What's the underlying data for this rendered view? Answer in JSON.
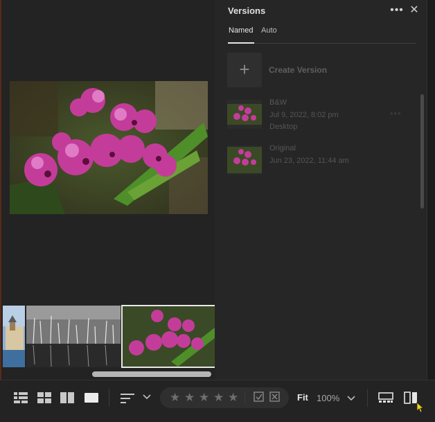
{
  "panel": {
    "title": "Versions",
    "more_icon": "more-horizontal-icon",
    "close_icon": "close-icon",
    "tabs": [
      {
        "label": "Named",
        "active": true
      },
      {
        "label": "Auto",
        "active": false
      }
    ],
    "create_label": "Create Version",
    "versions": [
      {
        "name": "B&W",
        "date": "Jul 9, 2022, 8:02 pm",
        "source": "Desktop",
        "thumb": "orchid"
      },
      {
        "name": "Original",
        "date": "Jun 23, 2022, 11:44 am",
        "source": "",
        "thumb": "orchid"
      }
    ]
  },
  "canvas": {
    "main_photo": "pink orchids",
    "filmstrip": [
      "castle by water",
      "bare trees reflection",
      "pink orchids"
    ],
    "selected_thumb_index": 2
  },
  "toolbar": {
    "view_icons": [
      "grid-small-icon",
      "grid-large-icon",
      "compare-view-icon",
      "single-view-icon"
    ],
    "sort_icon": "sort-icon",
    "rating_stars": 5,
    "rating_value": 0,
    "flag_icon": "flag-icon",
    "reject_icon": "reject-icon",
    "fit_label": "Fit",
    "zoom_label": "100%",
    "filmstrip_icon": "filmstrip-icon",
    "compare_icon": "split-compare-icon"
  },
  "colors": {
    "background": "#1e1e1e",
    "panel": "#262626",
    "accent_text": "#e6e6e6"
  }
}
